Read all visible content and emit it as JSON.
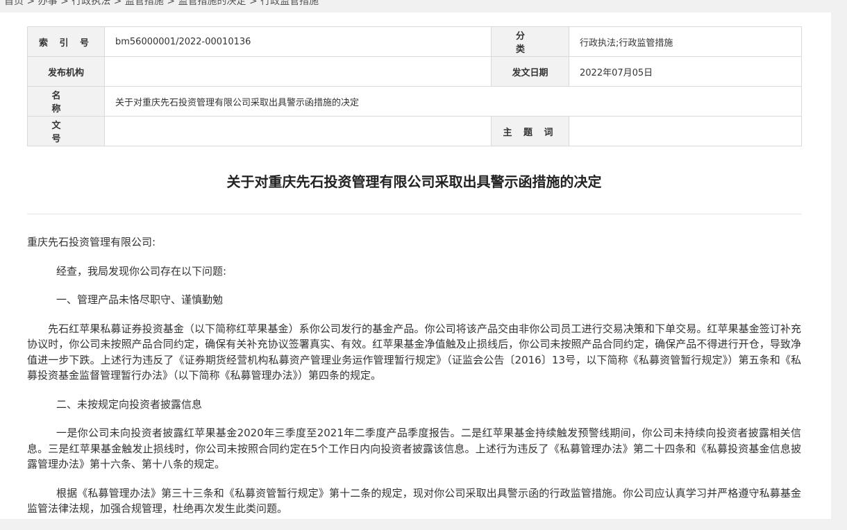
{
  "breadcrumb": "首页 > 办事 > 行政执法 > 监管措施 > 监管措施的决定 > 行政监管措施",
  "meta": {
    "index_label": "索 引 号",
    "index_value": "bm56000001/2022-00010136",
    "category_label": "分 类",
    "category_value": "行政执法;行政监管措施",
    "issuer_label": "发布机构",
    "issuer_value": "",
    "date_label": "发文日期",
    "date_value": "2022年07月05日",
    "name_label": "名 称",
    "name_value": "关于对重庆先石投资管理有限公司采取出具警示函措施的决定",
    "docno_label": "文 号",
    "docno_value": "",
    "keywords_label": "主 题 词",
    "keywords_value": ""
  },
  "document": {
    "title": "关于对重庆先石投资管理有限公司采取出具警示函措施的决定",
    "addressee": "重庆先石投资管理有限公司:",
    "paragraphs": [
      "经查，我局发现你公司存在以下问题:",
      "一、管理产品未恪尽职守、谨慎勤勉",
      "先石红苹果私募证券投资基金（以下简称红苹果基金）系你公司发行的基金产品。你公司将该产品交由非你公司员工进行交易决策和下单交易。红苹果基金签订补充协议时，你公司未按照产品合同约定，确保有关补充协议签署真实、有效。红苹果基金净值触及止损线后，你公司未按照产品合同约定，确保产品不得进行开仓，导致净值进一步下跌。上述行为违反了《证券期货经营机构私募资产管理业务运作管理暂行规定》（证监会公告〔2016〕13号，以下简称《私募资管暂行规定》）第五条和《私募投资基金监督管理暂行办法》（以下简称《私募管理办法》）第四条的规定。",
      "二、未按规定向投资者披露信息",
      "一是你公司未向投资者披露红苹果基金2020年三季度至2021年二季度产品季度报告。二是红苹果基金持续触发预警线期间，你公司未持续向投资者披露相关信息。三是红苹果基金触发止损线时，你公司未按照合同约定在5个工作日内向投资者披露该信息。上述行为违反了《私募管理办法》第二十四条和《私募投资基金信息披露管理办法》第十六条、第十八条的规定。",
      "根据《私募管理办法》第三十三条和《私募资管暂行规定》第十二条的规定，现对你公司采取出具警示函的行政监管措施。你公司应认真学习并严格遵守私募基金监管法律法规，加强合规管理，杜绝再次发生此类问题。"
    ]
  }
}
